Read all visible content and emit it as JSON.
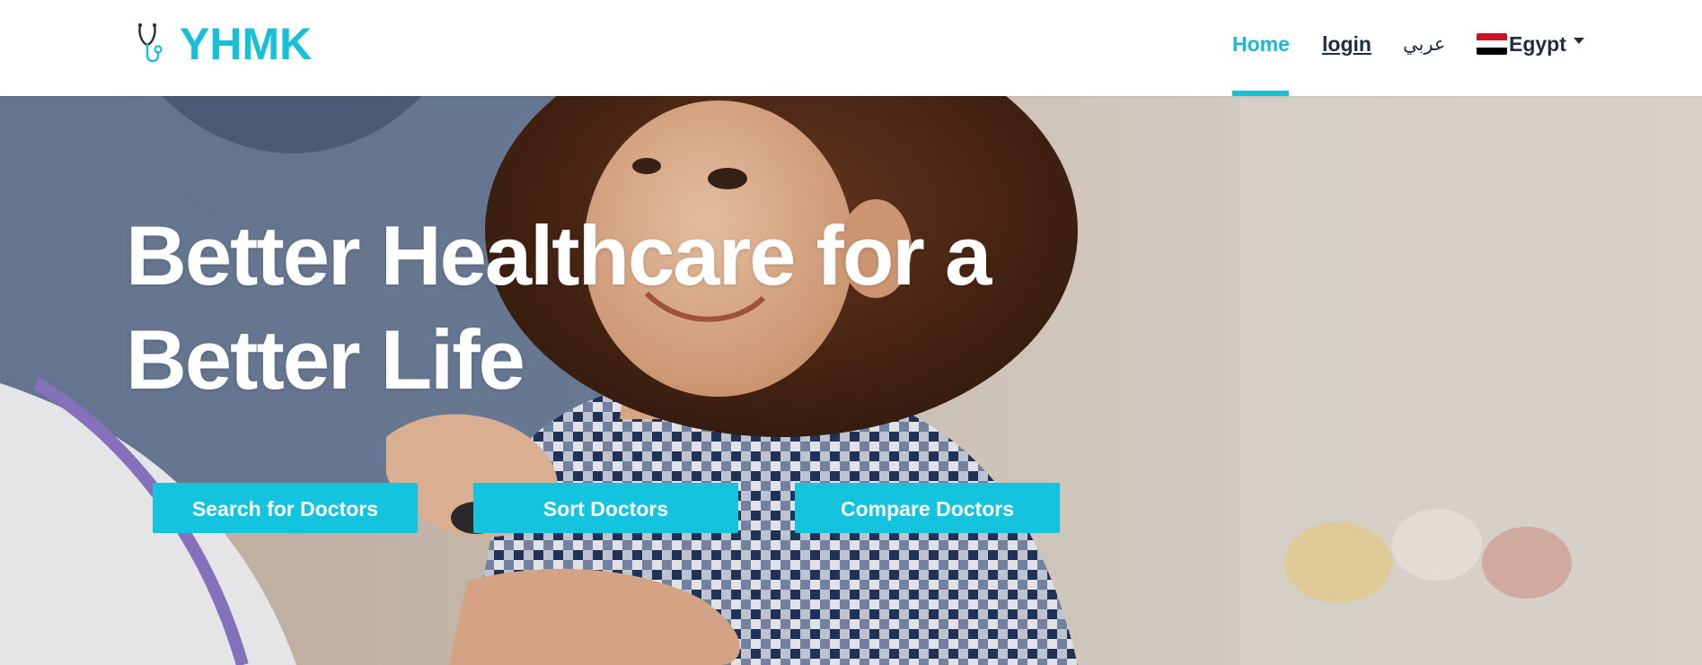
{
  "brand": {
    "name": "YHMK",
    "icon": "stethoscope-icon"
  },
  "nav": {
    "home": "Home",
    "login": "login",
    "language": "عربي",
    "country": {
      "label": "Egypt",
      "flag": "egypt-flag-icon"
    }
  },
  "hero": {
    "title_line1": "Better Healthcare for a",
    "title_line2": "Better Life",
    "buttons": {
      "search": "Search for Doctors",
      "sort": "Sort Doctors",
      "compare": "Compare Doctors"
    }
  },
  "colors": {
    "accent": "#18bfd9",
    "button": "#14c4de",
    "nav_text": "#1f2d3d"
  }
}
